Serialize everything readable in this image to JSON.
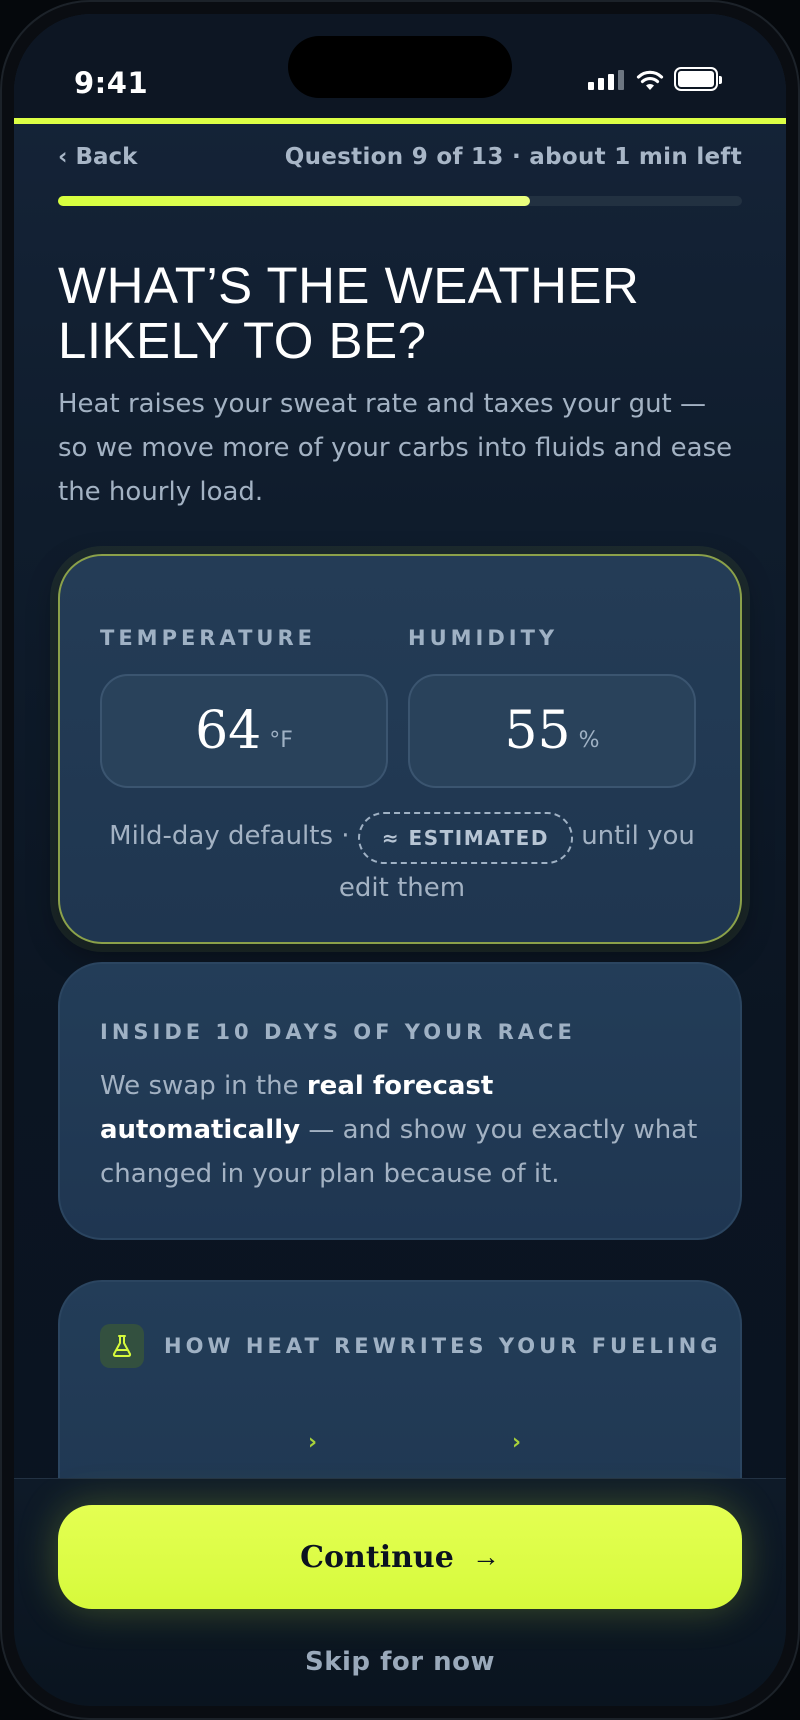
{
  "status_bar": {
    "time": "9:41"
  },
  "header": {
    "back_label": "‹ Back",
    "progress_text": "Question 9 of 13 · about 1 min left",
    "progress_fraction": 0.69
  },
  "question": {
    "title": "WHAT’S THE WEATHER LIKELY TO BE?",
    "subtitle": "Heat raises your sweat rate and taxes your gut — so we move more of your carbs into fluids and ease the hourly load."
  },
  "weather_card": {
    "temperature": {
      "label": "TEMPERATURE",
      "value": "64",
      "unit": "°F"
    },
    "humidity": {
      "label": "HUMIDITY",
      "value": "55",
      "unit": "%"
    },
    "note_prefix": "Mild-day defaults ·",
    "estimated_badge": "≈ ESTIMATED",
    "note_suffix": "until you edit them"
  },
  "forecast_card": {
    "label": "INSIDE 10 DAYS OF YOUR RACE",
    "text_before": "We swap in the ",
    "text_bold": "real forecast automatically",
    "text_after": " — and show you exactly what changed in your plan because of it."
  },
  "heat_card": {
    "icon": "flask-icon",
    "label": "HOW HEAT REWRITES YOUR FUELING",
    "chevron_1": "›",
    "chevron_2": "›"
  },
  "footer": {
    "continue_label": "Continue",
    "continue_arrow": "→",
    "skip_label": "Skip for now"
  },
  "colors": {
    "accent": "#dcff45",
    "background": "#0f1c2c",
    "card": "#223a55",
    "muted_text": "#a3b2c3"
  }
}
